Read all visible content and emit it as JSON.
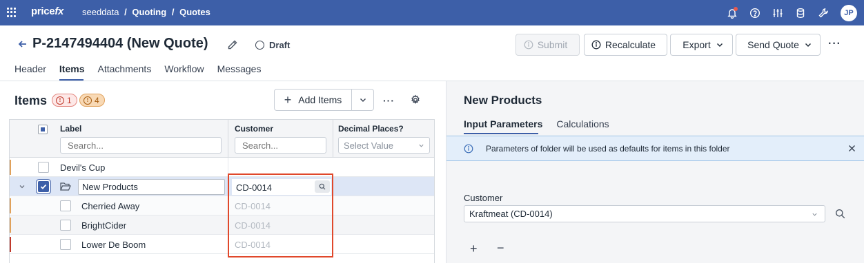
{
  "topbar": {
    "brand_main": "price",
    "brand_accent": "fx",
    "breadcrumb": {
      "root": "seeddata",
      "section": "Quoting",
      "page": "Quotes",
      "separator": "/"
    },
    "avatar_initials": "JP",
    "icons": [
      "apps-grid-icon",
      "bell-icon",
      "help-icon",
      "sliders-icon",
      "database-icon",
      "tools-icon"
    ],
    "notification_dot_color": "#e85a4f",
    "bar_color": "#3d5fa8"
  },
  "quote": {
    "title": "P-2147494404 (New Quote)",
    "status": "Draft"
  },
  "toolbar": {
    "submit_label": "Submit",
    "recalculate_label": "Recalculate",
    "export_label": "Export",
    "send_quote_label": "Send Quote",
    "more_label": "···"
  },
  "tabs": [
    {
      "label": "Header",
      "active": false
    },
    {
      "label": "Items",
      "active": true
    },
    {
      "label": "Attachments",
      "active": false
    },
    {
      "label": "Workflow",
      "active": false
    },
    {
      "label": "Messages",
      "active": false
    }
  ],
  "items_panel": {
    "title": "Items",
    "error_count": "1",
    "warning_count": "4",
    "add_items_label": "Add Items",
    "more_label": "···"
  },
  "table": {
    "columns": [
      {
        "label": "Label",
        "filter_placeholder": "Search..."
      },
      {
        "label": "Customer",
        "filter_placeholder": "Search..."
      },
      {
        "label": "Decimal Places?",
        "filter_placeholder": "Select Value"
      }
    ],
    "rows": [
      {
        "label": "Devil's Cup",
        "customer": "",
        "marker_color": "#e0a15b",
        "checked": false
      },
      {
        "label": "New Products",
        "customer": "CD-0014",
        "folder": true,
        "expanded": true,
        "checked": true,
        "editing": true
      },
      {
        "label": "Cherried Away",
        "customer": "CD-0014",
        "marker_color": "#e0a15b",
        "checked": false
      },
      {
        "label": "BrightCider",
        "customer": "CD-0014",
        "marker_color": "#e0a15b",
        "checked": false
      },
      {
        "label": "Lower De Boom",
        "customer": "CD-0014",
        "marker_color": "#c0392b",
        "checked": false
      }
    ],
    "highlight_color": "#e0482b"
  },
  "detail_panel": {
    "title": "New Products",
    "tabs": [
      {
        "label": "Input Parameters",
        "active": true
      },
      {
        "label": "Calculations",
        "active": false
      }
    ],
    "info_message": "Parameters of folder will be used as defaults for items in this folder",
    "customer_field_label": "Customer",
    "customer_value": "Kraftmeat (CD-0014)",
    "add_label": "+",
    "remove_label": "−"
  }
}
